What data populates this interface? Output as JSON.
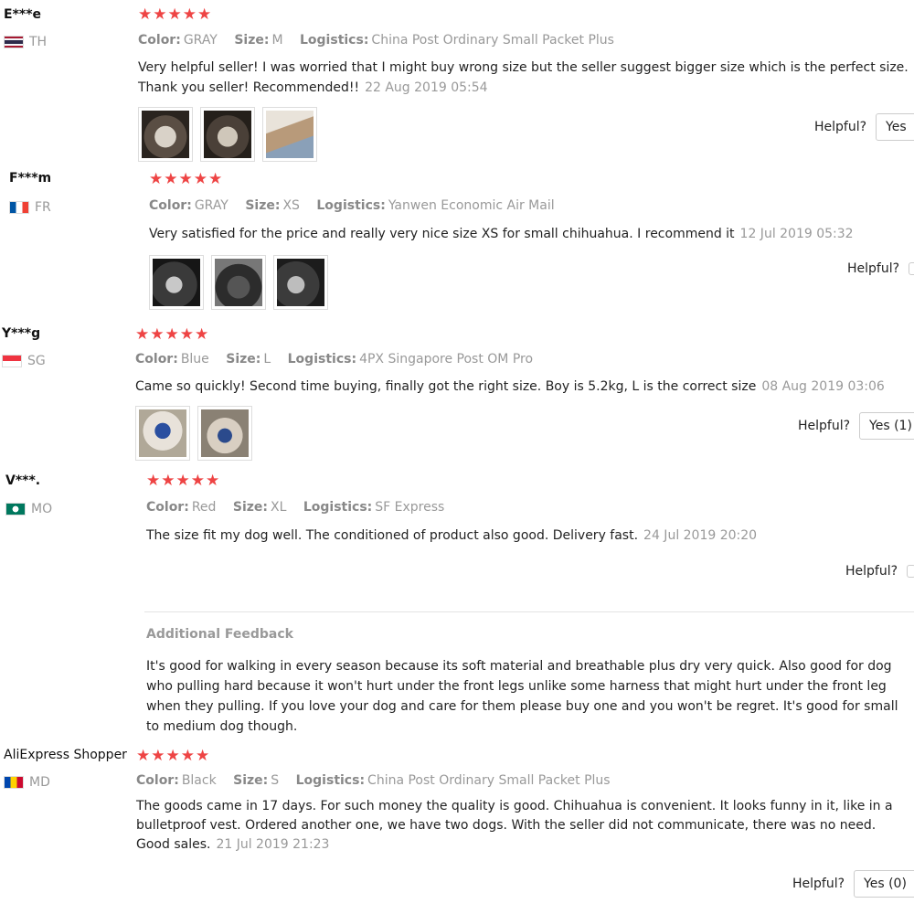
{
  "colors": {
    "star": "#ee4444",
    "muted": "#999999"
  },
  "reviews": [
    {
      "buyer": "E***e",
      "country": "TH",
      "stars": "★★★★★",
      "color_label": "Color:",
      "color": "GRAY",
      "size_label": "Size:",
      "size": "M",
      "logistics_label": "Logistics:",
      "logistics": "China Post Ordinary Small Packet Plus",
      "text": "Very helpful seller! I was worried that I might buy wrong size but the seller suggest bigger size which is the perfect size. Thank you seller! Recommended!!",
      "date": "22 Aug 2019 05:54",
      "photos": [
        "harness-photo",
        "harness-photo",
        "dog-photo"
      ],
      "helpful": "Helpful?",
      "yes": "Yes"
    },
    {
      "buyer": "F***m",
      "country": "FR",
      "stars": "★★★★★",
      "color_label": "Color:",
      "color": "GRAY",
      "size_label": "Size:",
      "size": "XS",
      "logistics_label": "Logistics:",
      "logistics": "Yanwen Economic Air Mail",
      "text": "Very satisfied for the price and really very nice size XS for small chihuahua. I recommend it",
      "date": "12 Jul 2019 05:32",
      "photos": [
        "harness-photo",
        "harness-photo",
        "harness-photo"
      ],
      "helpful": "Helpful?",
      "yes": ""
    },
    {
      "buyer": "Y***g",
      "country": "SG",
      "stars": "★★★★★",
      "color_label": "Color:",
      "color": "Blue",
      "size_label": "Size:",
      "size": "L",
      "logistics_label": "Logistics:",
      "logistics": "4PX Singapore Post OM Pro",
      "text": "Came so quickly! Second time buying, finally got the right size. Boy is 5.2kg, L is the correct size",
      "date": "08 Aug 2019 03:06",
      "photos": [
        "dog-photo",
        "dog-photo"
      ],
      "helpful": "Helpful?",
      "yes": "Yes (1)"
    },
    {
      "buyer": "V***.",
      "country": "MO",
      "stars": "★★★★★",
      "color_label": "Color:",
      "color": "Red",
      "size_label": "Size:",
      "size": "XL",
      "logistics_label": "Logistics:",
      "logistics": "SF Express",
      "text": "The size fit my dog well. The conditioned of product also good. Delivery fast.",
      "date": "24 Jul 2019 20:20",
      "helpful": "Helpful?",
      "yes": "",
      "additional_title": "Additional Feedback",
      "additional_text": "It's good for walking in every season because its soft material and breathable plus dry very quick. Also good for dog who pulling hard because it won't hurt under the front legs unlike some harness that might hurt under the front leg when they pulling. If you love your dog and care for them please buy one and you won't be regret. It's good for small to medium dog though."
    },
    {
      "buyer": "AliExpress Shopper",
      "country": "MD",
      "stars": "★★★★★",
      "color_label": "Color:",
      "color": "Black",
      "size_label": "Size:",
      "size": "S",
      "logistics_label": "Logistics:",
      "logistics": "China Post Ordinary Small Packet Plus",
      "text": "The goods came in 17 days. For such money the quality is good. Chihuahua is convenient. It looks funny in it, like in a bulletproof vest. Ordered another one, we have two dogs. With the seller did not communicate, there was no need. Good sales.",
      "date": "21 Jul 2019 21:23",
      "helpful": "Helpful?",
      "yes": "Yes (0)"
    }
  ]
}
